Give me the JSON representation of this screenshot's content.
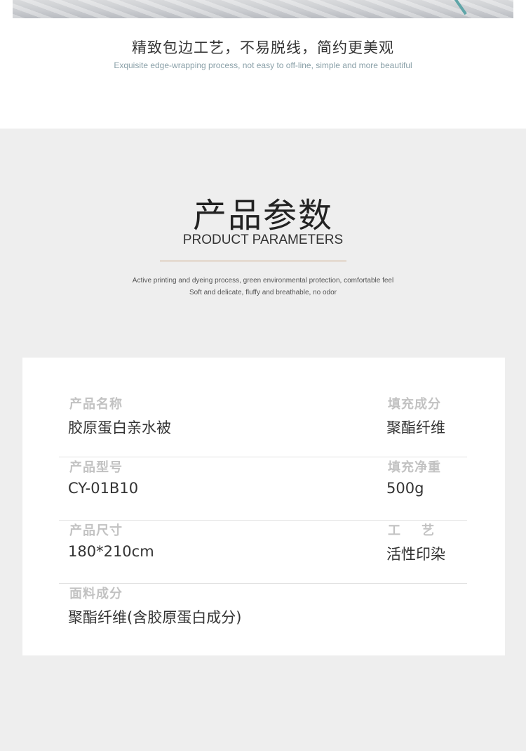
{
  "feature": {
    "title": "精致包边工艺，不易脱线，简约更美观",
    "subtitle": "Exquisite edge-wrapping process, not easy to off-line, simple and more beautiful"
  },
  "params": {
    "title_cn": "产品参数",
    "title_en": "PRODUCT PARAMETERS",
    "desc_line1": "Active printing and dyeing process, green environmental protection, comfortable feel",
    "desc_line2": "Soft and delicate, fluffy and breathable, no odor",
    "rows": [
      {
        "left": {
          "label": "产品名称",
          "value": "胶原蛋白亲水被"
        },
        "right": {
          "label": "填充成分",
          "value": "聚酯纤维"
        }
      },
      {
        "left": {
          "label": "产品型号",
          "value": "CY-01B10"
        },
        "right": {
          "label": "填充净重",
          "value": "500g"
        }
      },
      {
        "left": {
          "label": "产品尺寸",
          "value": "180*210cm"
        },
        "right": {
          "label": "工    艺",
          "value": "活性印染"
        }
      },
      {
        "left": {
          "label": "面料成分",
          "value": "聚酯纤维(含胶原蛋白成分)"
        }
      }
    ]
  },
  "colors": {
    "section_bg": "#eeeeee",
    "accent_line": "#c9a47e",
    "label": "#c2c2c2",
    "value": "#333333"
  }
}
